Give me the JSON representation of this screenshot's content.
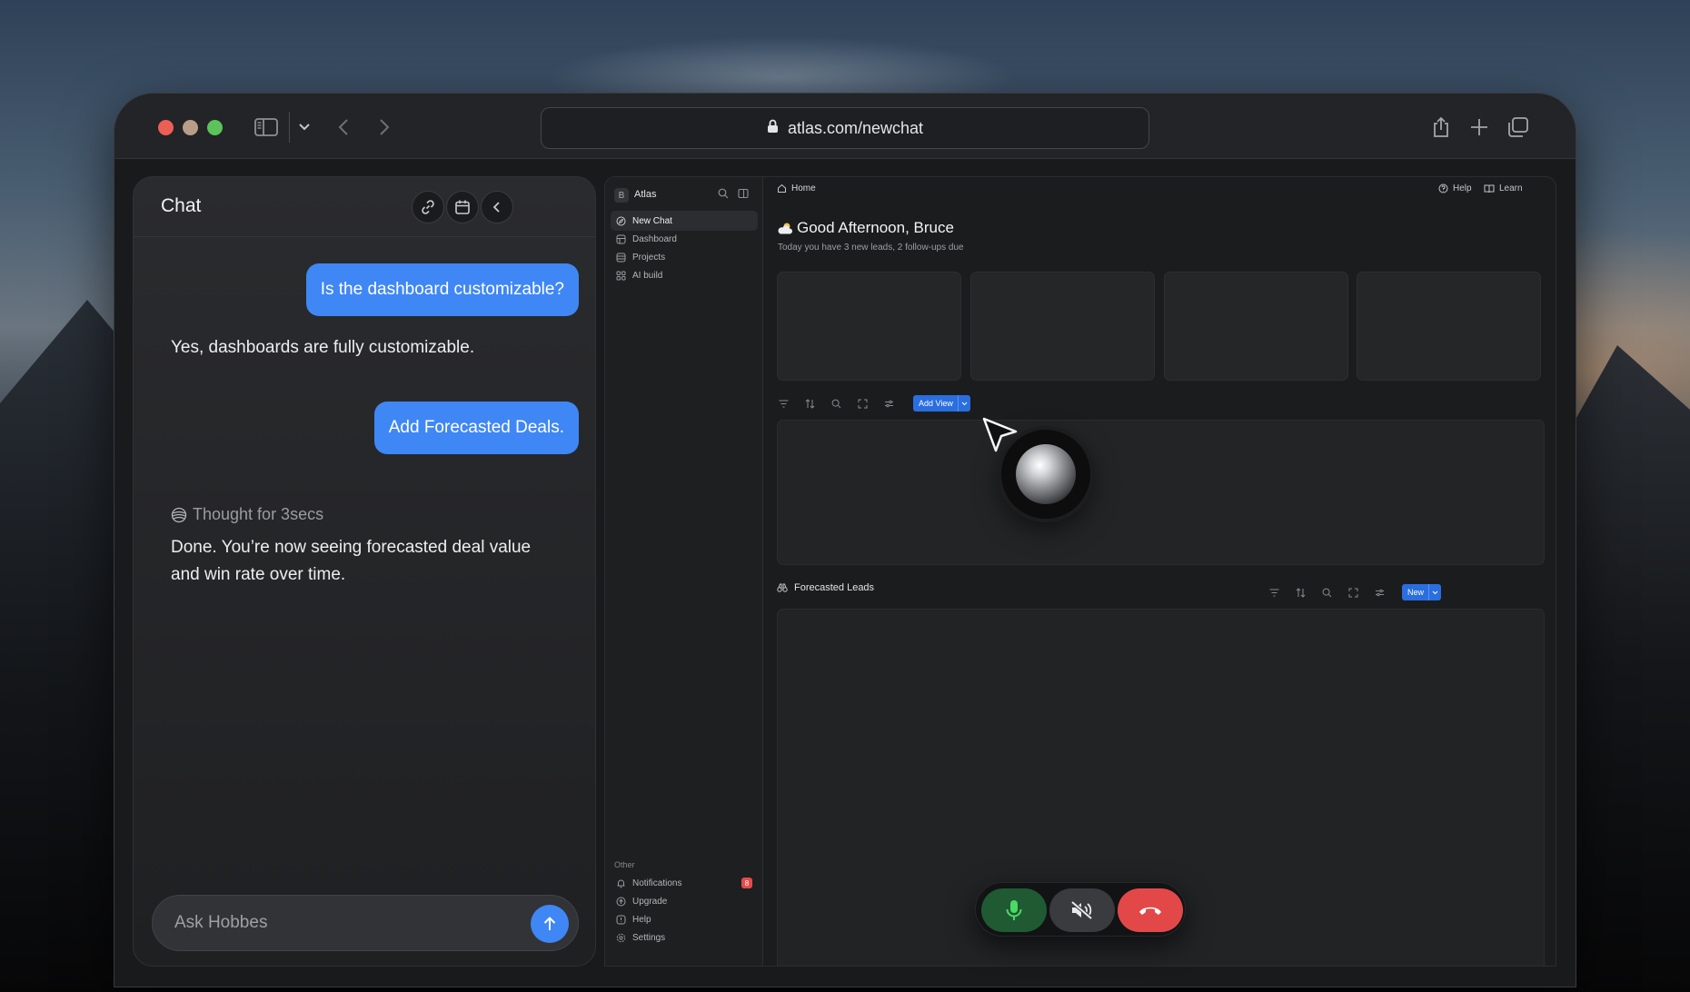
{
  "browser": {
    "url": "atlas.com/newchat"
  },
  "chat": {
    "title": "Chat",
    "messages": [
      {
        "role": "user",
        "text": "Is the dashboard customizable?"
      },
      {
        "role": "assistant",
        "text": "Yes, dashboards are fully customizable."
      },
      {
        "role": "user",
        "text": "Add Forecasted Deals."
      },
      {
        "role": "assistant",
        "text": "Done. You’re now seeing forecasted deal value and win rate over time."
      }
    ],
    "thought": "Thought for 3secs",
    "input_placeholder": "Ask Hobbes"
  },
  "sidebar": {
    "workspace_initial": "B",
    "workspace_name": "Atlas",
    "items": [
      {
        "label": "New Chat",
        "icon": "compass-icon",
        "active": true
      },
      {
        "label": "Dashboard",
        "icon": "dashboard-icon"
      },
      {
        "label": "Projects",
        "icon": "layers-icon"
      },
      {
        "label": "AI build",
        "icon": "grid-icon"
      }
    ],
    "section_other": "Other",
    "other_items": [
      {
        "label": "Notifications",
        "icon": "bell-icon",
        "badge": "8"
      },
      {
        "label": "Upgrade",
        "icon": "upgrade-icon"
      },
      {
        "label": "Help",
        "icon": "info-icon"
      },
      {
        "label": "Settings",
        "icon": "gear-icon"
      }
    ]
  },
  "main": {
    "breadcrumb": "Home",
    "help_label": "Help",
    "learn_label": "Learn",
    "greeting": "Good Afternoon, Bruce",
    "greeting_icon": "cloud-sun-icon",
    "subtext": "Today you have 3 new leads, 2 follow-ups due",
    "add_view_label": "Add View",
    "section_title": "Forecasted Leads",
    "new_label": "New"
  },
  "call_controls": {
    "mic": "mic-icon",
    "mute": "speaker-mute-icon",
    "end": "phone-hangup-icon",
    "colors": {
      "mic_bg": "#1f5a32",
      "mic_icon": "#4cd964",
      "end_bg": "#e34848"
    }
  },
  "colors": {
    "accent": "#3f87f5",
    "button_blue": "#2a6ee0"
  }
}
